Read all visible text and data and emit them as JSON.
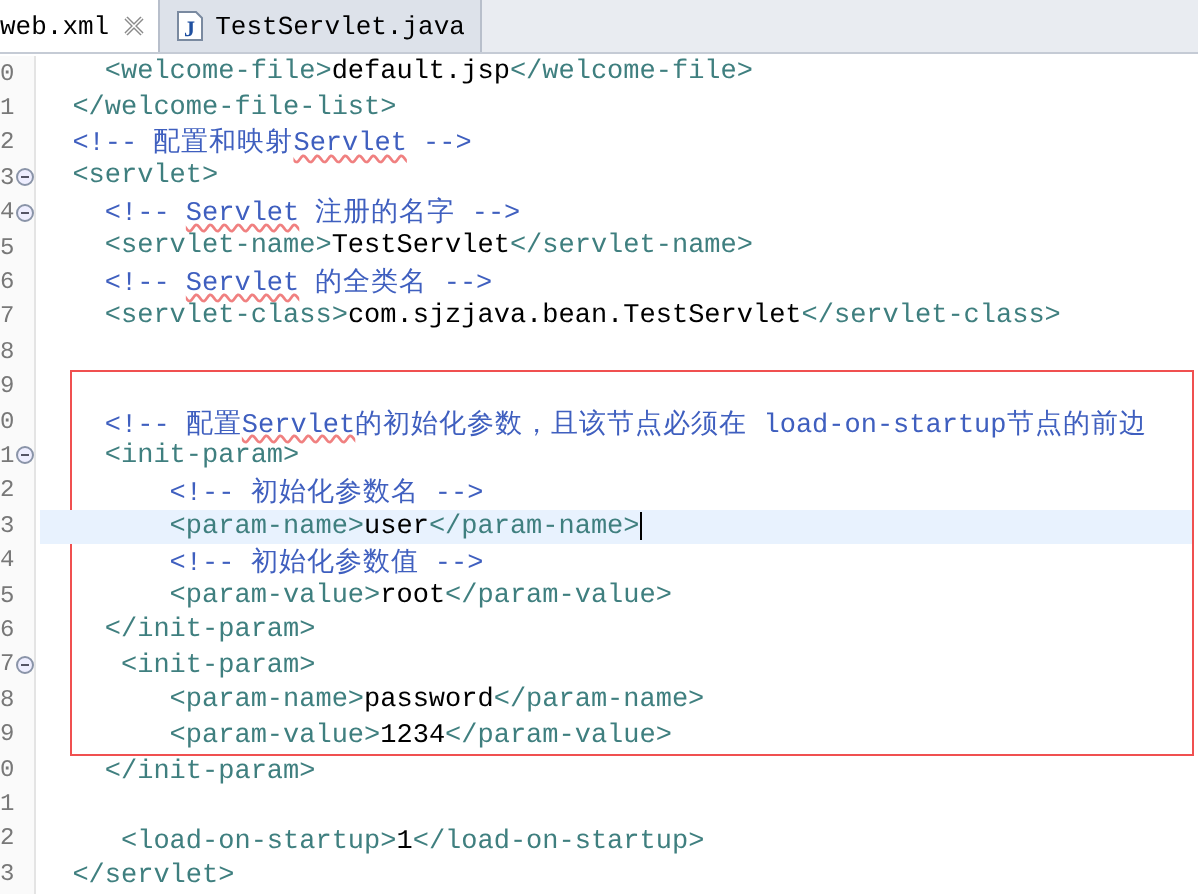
{
  "tabs": [
    {
      "label": "web.xml",
      "selected": true,
      "kind": "xml"
    },
    {
      "label": "TestServlet.java",
      "selected": false,
      "kind": "java",
      "icon": "J"
    }
  ],
  "editor": {
    "lines": [
      {
        "number": "0",
        "fold": false,
        "current": false,
        "boxed": false,
        "segments": [
          {
            "kind": "tag",
            "text": "    <welcome-file>"
          },
          {
            "kind": "text",
            "text": "default.jsp"
          },
          {
            "kind": "tag",
            "text": "</welcome-file>"
          }
        ]
      },
      {
        "number": "1",
        "fold": false,
        "current": false,
        "boxed": false,
        "segments": [
          {
            "kind": "tag",
            "text": "  </welcome-file-list>"
          }
        ]
      },
      {
        "number": "2",
        "fold": false,
        "current": false,
        "boxed": false,
        "segments": [
          {
            "kind": "comment",
            "text": "  <!-- 配置和映射"
          },
          {
            "kind": "misspelled",
            "text": "Servlet"
          },
          {
            "kind": "comment",
            "text": " -->"
          }
        ]
      },
      {
        "number": "3",
        "fold": true,
        "current": false,
        "boxed": false,
        "segments": [
          {
            "kind": "tag",
            "text": "  <servlet>"
          }
        ]
      },
      {
        "number": "4",
        "fold": true,
        "current": false,
        "boxed": false,
        "segments": [
          {
            "kind": "comment",
            "text": "    <!-- "
          },
          {
            "kind": "misspelled",
            "text": "Servlet"
          },
          {
            "kind": "comment",
            "text": " 注册的名字 -->"
          }
        ]
      },
      {
        "number": "5",
        "fold": false,
        "current": false,
        "boxed": false,
        "segments": [
          {
            "kind": "tag",
            "text": "    <servlet-name>"
          },
          {
            "kind": "text",
            "text": "TestServlet"
          },
          {
            "kind": "tag",
            "text": "</servlet-name>"
          }
        ]
      },
      {
        "number": "6",
        "fold": false,
        "current": false,
        "boxed": false,
        "segments": [
          {
            "kind": "comment",
            "text": "    <!-- "
          },
          {
            "kind": "misspelled",
            "text": "Servlet"
          },
          {
            "kind": "comment",
            "text": " 的全类名 -->"
          }
        ]
      },
      {
        "number": "7",
        "fold": false,
        "current": false,
        "boxed": false,
        "segments": [
          {
            "kind": "tag",
            "text": "    <servlet-class>"
          },
          {
            "kind": "text",
            "text": "com.sjzjava.bean.TestServlet"
          },
          {
            "kind": "tag",
            "text": "</servlet-class>"
          }
        ]
      },
      {
        "number": "8",
        "fold": false,
        "current": false,
        "boxed": false
      },
      {
        "number": "9",
        "fold": false,
        "current": false,
        "boxed": true
      },
      {
        "number": "0",
        "fold": false,
        "current": false,
        "boxed": true,
        "segments": [
          {
            "kind": "comment",
            "text": "    <!-- 配置"
          },
          {
            "kind": "misspelled",
            "text": "Servlet"
          },
          {
            "kind": "comment",
            "text": "的初始化参数，且该节点必须在 load-on-startup节点的前边"
          }
        ]
      },
      {
        "number": "1",
        "fold": true,
        "current": false,
        "boxed": true,
        "segments": [
          {
            "kind": "tag",
            "text": "    <init-param>"
          }
        ]
      },
      {
        "number": "2",
        "fold": false,
        "current": false,
        "boxed": true,
        "segments": [
          {
            "kind": "comment",
            "text": "        <!-- 初始化参数名 -->"
          }
        ]
      },
      {
        "number": "3",
        "fold": false,
        "current": true,
        "boxed": true,
        "segments": [
          {
            "kind": "tag",
            "text": "        <param-name>"
          },
          {
            "kind": "text",
            "text": "user"
          },
          {
            "kind": "tag",
            "text": "</param-name>"
          }
        ]
      },
      {
        "number": "4",
        "fold": false,
        "current": false,
        "boxed": true,
        "segments": [
          {
            "kind": "comment",
            "text": "        <!-- 初始化参数值 -->"
          }
        ]
      },
      {
        "number": "5",
        "fold": false,
        "current": false,
        "boxed": true,
        "segments": [
          {
            "kind": "tag",
            "text": "        <param-value>"
          },
          {
            "kind": "text",
            "text": "root"
          },
          {
            "kind": "tag",
            "text": "</param-value>"
          }
        ]
      },
      {
        "number": "6",
        "fold": false,
        "current": false,
        "boxed": true,
        "segments": [
          {
            "kind": "tag",
            "text": "    </init-param>"
          }
        ]
      },
      {
        "number": "7",
        "fold": true,
        "current": false,
        "boxed": true,
        "segments": [
          {
            "kind": "tag",
            "text": "     <init-param>"
          }
        ]
      },
      {
        "number": "8",
        "fold": false,
        "current": false,
        "boxed": true,
        "segments": [
          {
            "kind": "tag",
            "text": "        <param-name>"
          },
          {
            "kind": "text",
            "text": "password"
          },
          {
            "kind": "tag",
            "text": "</param-name>"
          }
        ]
      },
      {
        "number": "9",
        "fold": false,
        "current": false,
        "boxed": true,
        "segments": [
          {
            "kind": "tag",
            "text": "        <param-value>"
          },
          {
            "kind": "text",
            "text": "1234"
          },
          {
            "kind": "tag",
            "text": "</param-value>"
          }
        ]
      },
      {
        "number": "0",
        "fold": false,
        "current": false,
        "boxed": false,
        "segments": [
          {
            "kind": "tag",
            "text": "    </init-param>"
          }
        ]
      },
      {
        "number": "1",
        "fold": false,
        "current": false,
        "boxed": false
      },
      {
        "number": "2",
        "fold": false,
        "current": false,
        "boxed": false,
        "segments": [
          {
            "kind": "tag",
            "text": "     <load-on-startup>"
          },
          {
            "kind": "text",
            "text": "1"
          },
          {
            "kind": "tag",
            "text": "</load-on-startup>"
          }
        ]
      },
      {
        "number": "3",
        "fold": false,
        "current": false,
        "boxed": false,
        "segments": [
          {
            "kind": "tag",
            "text": "  </servlet>"
          }
        ]
      }
    ]
  }
}
